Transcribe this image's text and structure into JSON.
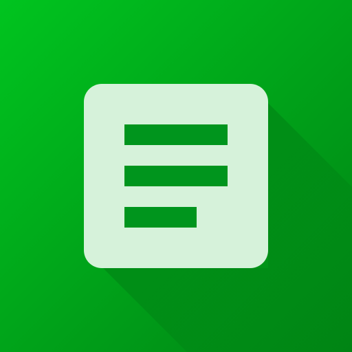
{
  "app_icon": {
    "icon": "notes-document-icon",
    "colors": {
      "background_top": "#00c41f",
      "background_bottom": "#008414",
      "long_shadow": "#006b10",
      "card": "#d6f2da",
      "lines": "#00951d"
    }
  }
}
